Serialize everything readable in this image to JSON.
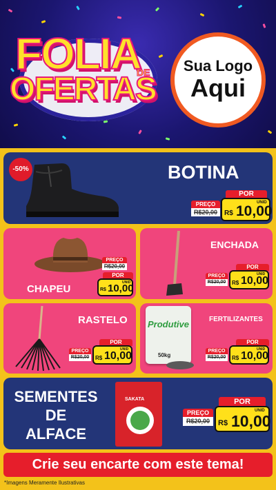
{
  "header": {
    "title_line1": "FOLIA",
    "title_de": "DE",
    "title_line2": "OFERTAS",
    "logo_line1": "Sua Logo",
    "logo_line2": "Aqui"
  },
  "colors": {
    "navy": "#233578",
    "pink": "#f0457c",
    "yellow": "#f3c21a",
    "red": "#e61e2b"
  },
  "products": {
    "botina": {
      "name": "BOTINA",
      "badge": "-50%",
      "por": "POR",
      "preco": "PREÇO",
      "old": "R$20,00",
      "rs": "R$",
      "price": "10,00",
      "unid": "UNID",
      "icon": "boot-icon"
    },
    "chapeu": {
      "name": "CHAPEU",
      "por": "POR",
      "preco": "PREÇO",
      "old": "R$20,00",
      "rs": "R$",
      "price": "10,00",
      "unid": "UNID",
      "icon": "hat-icon"
    },
    "enchada": {
      "name": "ENCHADA",
      "por": "POR",
      "preco": "PREÇO",
      "old": "R$20,00",
      "rs": "R$",
      "price": "10,00",
      "unid": "UNID",
      "icon": "hoe-icon"
    },
    "rastelo": {
      "name": "RASTELO",
      "por": "POR",
      "preco": "PREÇO",
      "old": "R$20,00",
      "rs": "R$",
      "price": "10,00",
      "unid": "UNID",
      "icon": "rake-icon"
    },
    "fertilizantes": {
      "name": "FERTILIZANTES",
      "bag_label": "Produtive",
      "bag_weight": "50kg",
      "por": "POR",
      "preco": "PREÇO",
      "old": "R$20,00",
      "rs": "R$",
      "price": "10,00",
      "unid": "UNID",
      "icon": "fertilizer-bag-icon"
    },
    "sementes": {
      "name_l1": "SEMENTES",
      "name_l2": "DE",
      "name_l3": "ALFACE",
      "pack_brand": "SAKATA",
      "por": "POR",
      "preco": "PREÇO",
      "old": "R$20,00",
      "rs": "R$",
      "price": "10,00",
      "unid": "UNID",
      "icon": "seed-pack-icon"
    }
  },
  "cta": "Crie seu encarte com este tema!",
  "footnote": "*Imagens Meramente Ilustrativas"
}
